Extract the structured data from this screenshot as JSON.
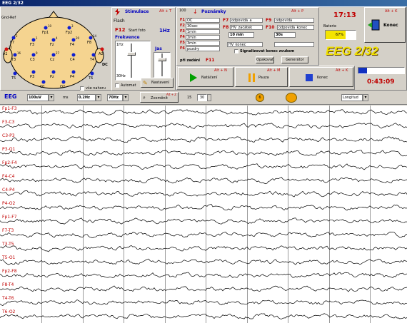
{
  "window": {
    "title": "EEG 2/32"
  },
  "head": {
    "label": "Gnd-Ref",
    "electrodes": [
      "Fp1",
      "Fp2",
      "F7",
      "F3",
      "Fz",
      "F4",
      "F8",
      "A1",
      "T3",
      "C3",
      "Cz",
      "C4",
      "T4",
      "A2",
      "T5",
      "P3",
      "Pz",
      "P4",
      "T6",
      "O1",
      "O2"
    ],
    "dc_label": "DC",
    "notes": [
      "10",
      "3",
      "2",
      "1",
      "4",
      "20",
      "14",
      "22",
      "16",
      "9",
      "27"
    ]
  },
  "stim": {
    "title": "Stimulace",
    "hotkey": "Alt + T",
    "flash_label": "Flash",
    "f12": "F12",
    "start_label": "Start foto",
    "freq_value": "1Hz",
    "freq_title": "Frekvence",
    "scale_top": "1Hz",
    "scale_bottom": "30Hz",
    "jas_label": "Jas",
    "auto_label": "Automat",
    "nastaveni": "Nastavení",
    "all_label": "vše nahoru"
  },
  "notes": {
    "title": "Poznámky",
    "hotkey": "Alt + P",
    "f_rows": [
      {
        "key": "F1",
        "text": "OC"
      },
      {
        "key": "F2",
        "text": "30sec"
      },
      {
        "key": "F3",
        "text": "1min"
      },
      {
        "key": "F4",
        "text": "2min"
      },
      {
        "key": "F5",
        "text": "3min"
      },
      {
        "key": "F6",
        "text": "pozdry"
      }
    ],
    "f7": {
      "key": "F7",
      "text": "odpovídá_a_"
    },
    "f8": {
      "key": "F8",
      "text": "HV_začátek"
    },
    "f9": {
      "key": "F9",
      "text": "odpovídá"
    },
    "f10": {
      "key": "F10",
      "text": "odpovídá_konec"
    },
    "hv_konec": "HV_konec",
    "min_select": "10 min",
    "sec_select": "30s",
    "f_ext": "F11",
    "ext_label": "při zadání",
    "signal_label": "Signalizovat konec zvukem",
    "f12b": "F12",
    "opak": "Opakovat",
    "generator": "Generátor",
    "num_label": "100"
  },
  "time": {
    "clock": "17:13",
    "battery_label": "Baterie",
    "battery_pct": "67%",
    "battery_level": 0.67
  },
  "konec": {
    "label": "Konec",
    "hotkey": "Alt + K"
  },
  "logo": "EEG 2/32",
  "controls": {
    "start": {
      "label": "Natáčení",
      "hotkey": "Alt + N"
    },
    "pause": {
      "label": "Pauza",
      "hotkey": "Alt + M"
    },
    "stop": {
      "label": "Konec",
      "hotkey": "Alt + K"
    }
  },
  "elapsed": "0:43:09",
  "toolbar": {
    "eeg_label": "EEG",
    "gain": "100uV",
    "ms_label": "ms",
    "hp": "0.2Hz",
    "lp": "70Hz",
    "zoom": "Zvoměnit",
    "zoom_hotkey": "Alt + Z",
    "sec15": "15",
    "sec30": "30",
    "montage": "Longitud"
  },
  "channels": [
    "Fp1-F3",
    "F3-C3",
    "C3-P3",
    "P3-O1",
    "Fp2-F4",
    "F4-C4",
    "C4-P4",
    "P4-O2",
    "Fp1-F7",
    "F7-T3",
    "T3-T5",
    "T5-O1",
    "Fp2-F8",
    "F8-T4",
    "T4-T6",
    "T6-O2"
  ],
  "colors": {
    "trace": "#000000",
    "label": "#c00000",
    "accent": "#0000c0"
  }
}
